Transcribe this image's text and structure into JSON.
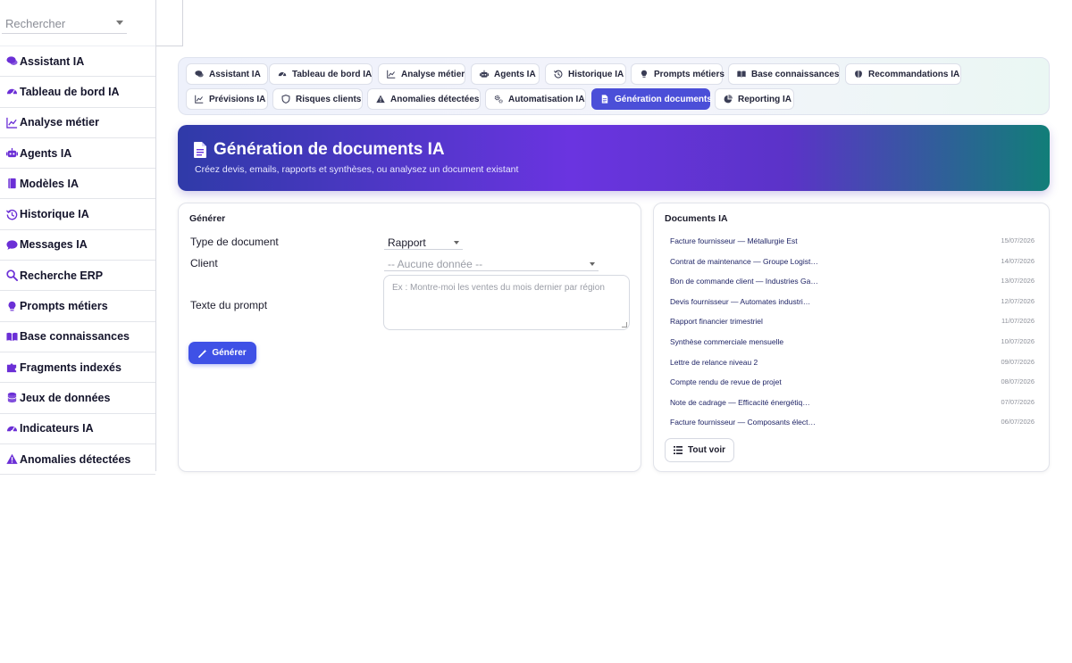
{
  "search": {
    "placeholder": "Rechercher"
  },
  "sidebar": {
    "items": [
      {
        "label": "Assistant IA",
        "icon": "chat-icon"
      },
      {
        "label": "Tableau de bord IA",
        "icon": "gauge-icon"
      },
      {
        "label": "Analyse métier",
        "icon": "chart-line-icon"
      },
      {
        "label": "Agents IA",
        "icon": "robot-icon"
      },
      {
        "label": "Modèles IA",
        "icon": "book-icon"
      },
      {
        "label": "Historique IA",
        "icon": "history-icon"
      },
      {
        "label": "Messages IA",
        "icon": "message-icon"
      },
      {
        "label": "Recherche ERP",
        "icon": "search-icon"
      },
      {
        "label": "Prompts métiers",
        "icon": "lightbulb-icon"
      },
      {
        "label": "Base connaissances",
        "icon": "open-book-icon"
      },
      {
        "label": "Fragments indexés",
        "icon": "puzzle-icon"
      },
      {
        "label": "Jeux de données",
        "icon": "database-icon"
      },
      {
        "label": "Indicateurs IA",
        "icon": "gauge-icon"
      },
      {
        "label": "Anomalies détectées",
        "icon": "warning-icon"
      }
    ]
  },
  "tabs": [
    {
      "label": "Assistant IA",
      "icon": "chat-icon"
    },
    {
      "label": "Tableau de bord IA",
      "icon": "gauge-icon"
    },
    {
      "label": "Analyse métier",
      "icon": "chart-line-icon"
    },
    {
      "label": "Agents IA",
      "icon": "robot-icon"
    },
    {
      "label": "Historique IA",
      "icon": "history-icon"
    },
    {
      "label": "Prompts métiers",
      "icon": "lightbulb-icon"
    },
    {
      "label": "Base connaissances",
      "icon": "open-book-icon"
    },
    {
      "label": "Recommandations IA",
      "icon": "brain-icon"
    },
    {
      "label": "Prévisions IA",
      "icon": "chart-line-icon"
    },
    {
      "label": "Risques clients",
      "icon": "shield-icon"
    },
    {
      "label": "Anomalies détectées",
      "icon": "warning-icon"
    },
    {
      "label": "Automatisation IA",
      "icon": "cogs-icon"
    },
    {
      "label": "Génération documents",
      "icon": "document-icon",
      "active": true
    },
    {
      "label": "Reporting IA",
      "icon": "pie-chart-icon"
    }
  ],
  "hero": {
    "title": "Génération de documents IA",
    "subtitle": "Créez devis, emails, rapports et synthèses, ou analysez un document existant",
    "gradient_start": "#2f3aa8",
    "gradient_mid": "#6a34e0",
    "gradient_end": "#117e78"
  },
  "generate": {
    "title": "Générer",
    "doc_type_label": "Type de document",
    "doc_type_value": "Rapport",
    "client_label": "Client",
    "client_value": "-- Aucune donnée --",
    "prompt_label": "Texte du prompt",
    "prompt_placeholder": "Ex : Montre-moi les ventes du mois dernier par région",
    "button_label": "Générer",
    "button_color": "#3f51e6"
  },
  "documents": {
    "title": "Documents IA",
    "items": [
      {
        "name": "Facture fournisseur — Métallurgie Est",
        "date": "15/07/2026"
      },
      {
        "name": "Contrat de maintenance — Groupe Logist…",
        "date": "14/07/2026"
      },
      {
        "name": "Bon de commande client — Industries Ga…",
        "date": "13/07/2026"
      },
      {
        "name": "Devis fournisseur — Automates industri…",
        "date": "12/07/2026"
      },
      {
        "name": "Rapport financier trimestriel",
        "date": "11/07/2026"
      },
      {
        "name": "Synthèse commerciale mensuelle",
        "date": "10/07/2026"
      },
      {
        "name": "Lettre de relance niveau 2",
        "date": "09/07/2026"
      },
      {
        "name": "Compte rendu de revue de projet",
        "date": "08/07/2026"
      },
      {
        "name": "Note de cadrage — Efficacité énergétiq…",
        "date": "07/07/2026"
      },
      {
        "name": "Facture fournisseur — Composants élect…",
        "date": "06/07/2026"
      }
    ],
    "see_all_label": "Tout voir"
  },
  "colors": {
    "accent": "#4b4fd8",
    "sidebar_icon": "#6b2fd6"
  }
}
